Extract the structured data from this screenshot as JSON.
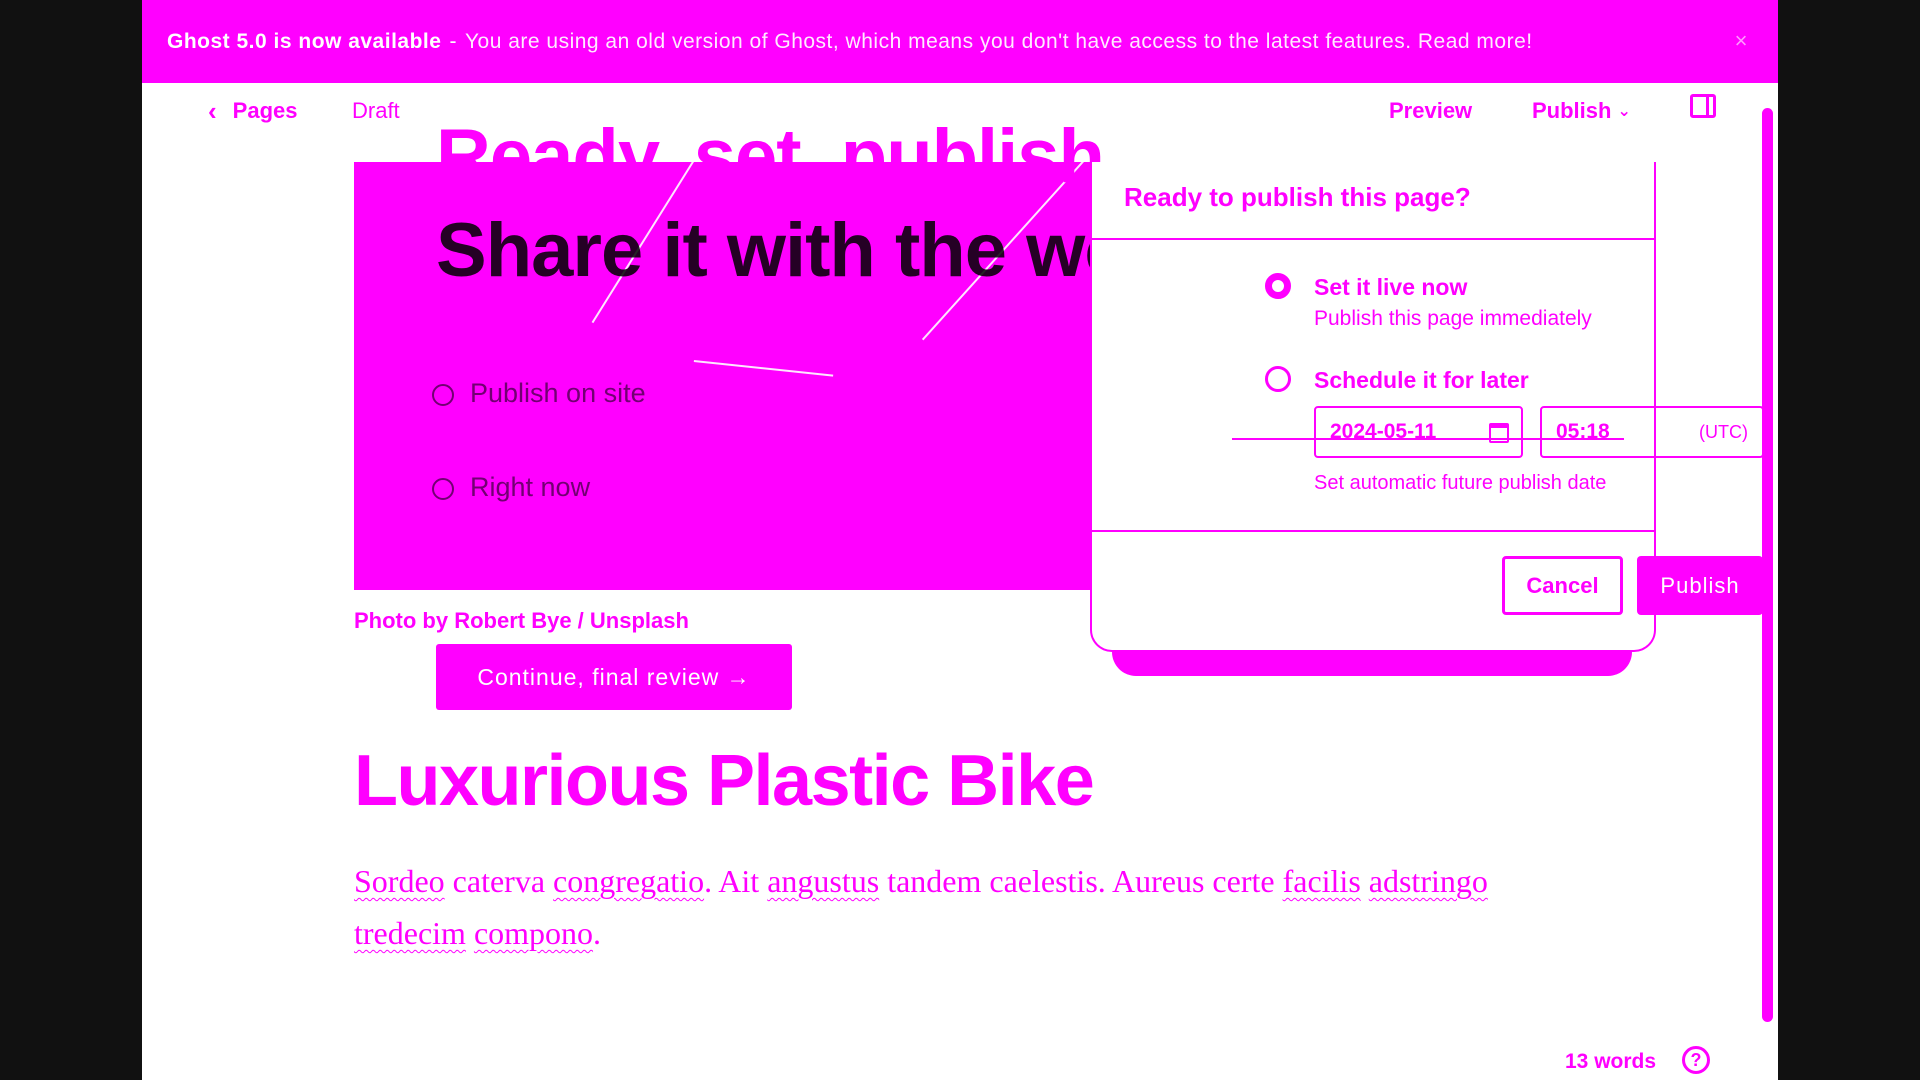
{
  "banner": {
    "title": "Ghost 5.0 is now available",
    "separator": "-",
    "message": "You are using an old version of Ghost, which means you don't have access to the latest features. Read more!",
    "close_glyph": "×"
  },
  "header": {
    "back_label": "Pages",
    "status": "Draft",
    "preview_label": "Preview",
    "publish_label": "Publish"
  },
  "overlay": {
    "headline_line1": "Ready, set, publish.",
    "headline_line2": "Share it with the world.",
    "option_a": "Publish on site",
    "option_b": "Right now"
  },
  "feature_image": {
    "caption": "Photo by Robert Bye / Unsplash"
  },
  "continue_button": "Continue, final review →",
  "post": {
    "title": "Luxurious Plastic Bike",
    "body_words": [
      {
        "t": "Sordeo",
        "u": true
      },
      {
        "t": " caterva ",
        "u": false
      },
      {
        "t": "congregatio",
        "u": true
      },
      {
        "t": ". Ait ",
        "u": false
      },
      {
        "t": "angustus",
        "u": true
      },
      {
        "t": " tandem caelestis. Aureus certe ",
        "u": false
      },
      {
        "t": "facilis",
        "u": true
      },
      {
        "t": " ",
        "u": false
      },
      {
        "t": "adstringo",
        "u": true
      },
      {
        "t": " ",
        "u": false
      },
      {
        "t": "tredecim",
        "u": true
      },
      {
        "t": " ",
        "u": false
      },
      {
        "t": "compono",
        "u": true
      },
      {
        "t": ".",
        "u": false
      }
    ]
  },
  "footer": {
    "word_count": "13 words",
    "help_glyph": "?"
  },
  "publish_popover": {
    "title": "Ready to publish this page?",
    "option_now_label": "Set it live now",
    "option_now_desc": "Publish this page immediately",
    "option_later_label": "Schedule it for later",
    "date_value": "2024-05-11",
    "time_value": "05:18",
    "timezone": "(UTC)",
    "hint": "Set automatic future publish date",
    "cancel_label": "Cancel",
    "publish_label": "Publish",
    "selected_option": "now"
  },
  "colors": {
    "accent": "#ff00ff",
    "background": "#ffffff",
    "outer": "#111111"
  },
  "icons": [
    "chevron-left-icon",
    "chevron-down-icon",
    "sidebar-toggle-icon",
    "calendar-icon",
    "help-icon",
    "close-icon"
  ]
}
